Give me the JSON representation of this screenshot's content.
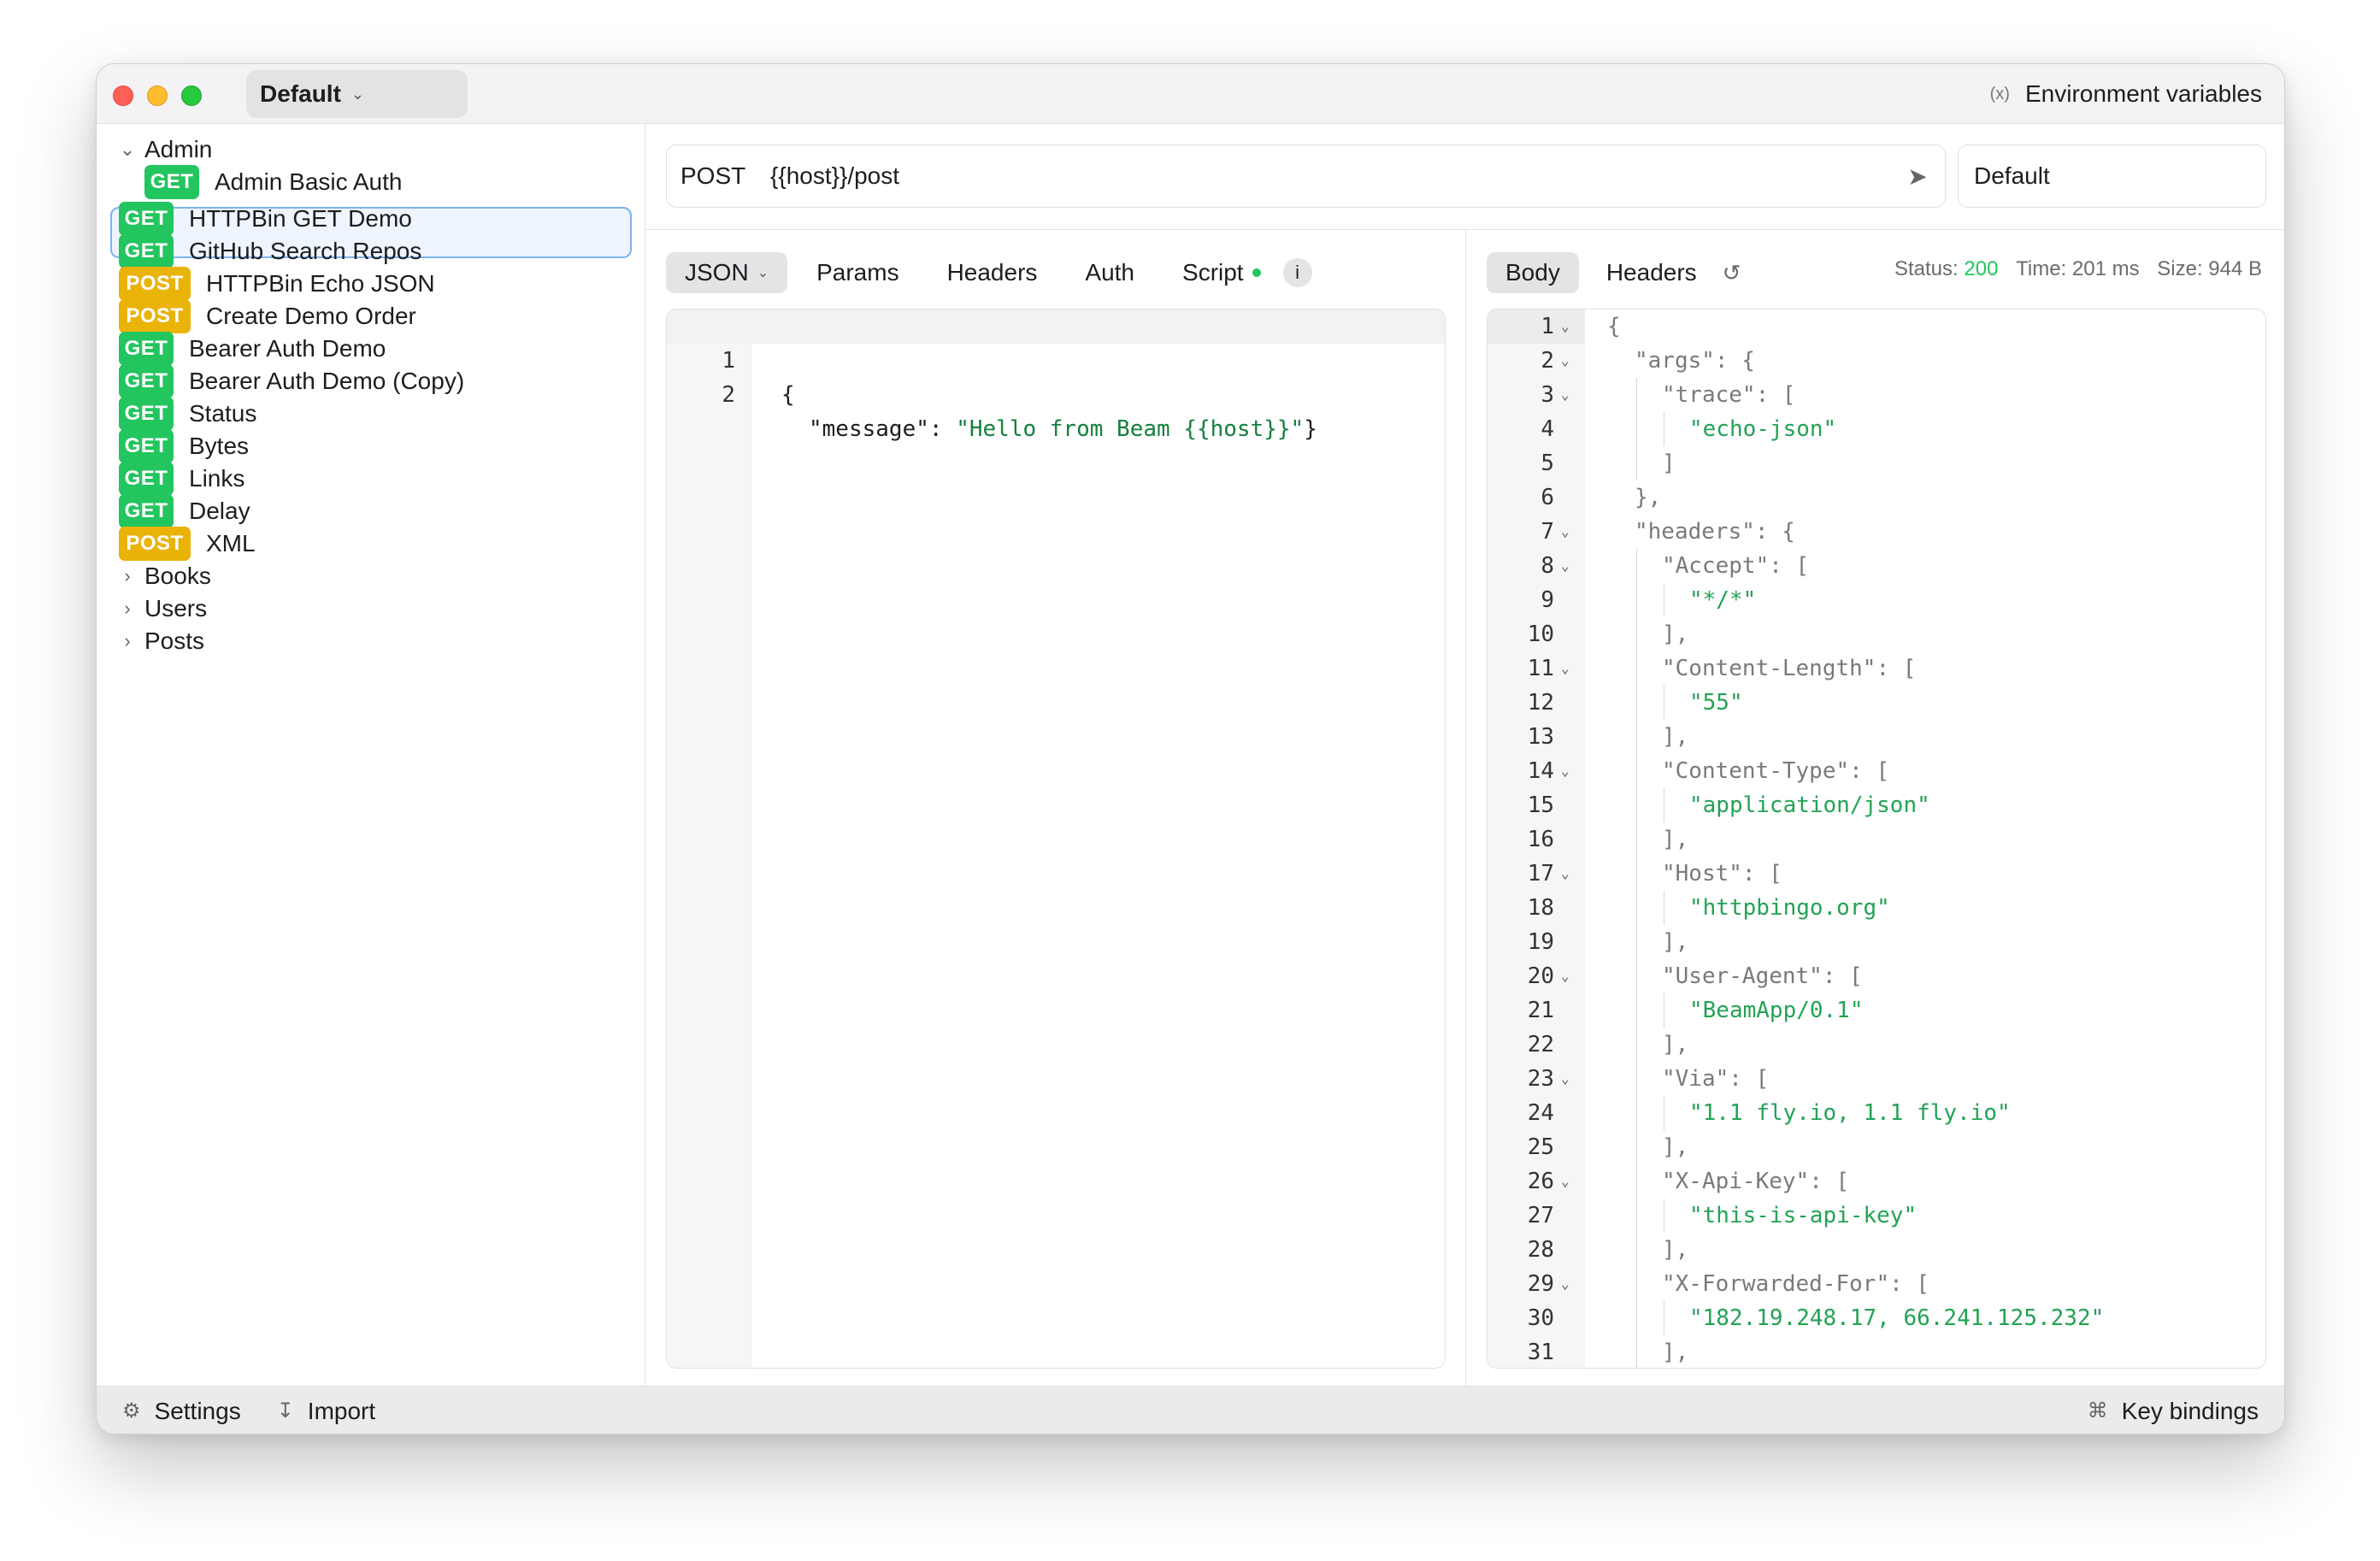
{
  "window": {
    "environment_selector": "Default",
    "env_variables_label": "Environment variables"
  },
  "sidebar": {
    "admin_folder": "Admin",
    "admin_items": [
      {
        "method": "GET",
        "label": "Admin Basic Auth"
      }
    ],
    "items": [
      {
        "method": "GET",
        "label": "HTTPBin GET Demo"
      },
      {
        "method": "GET",
        "label": "GitHub Search Repos"
      },
      {
        "method": "POST",
        "label": "HTTPBin Echo JSON",
        "selected": true
      },
      {
        "method": "POST",
        "label": "Create Demo Order"
      },
      {
        "method": "GET",
        "label": "Bearer Auth Demo"
      },
      {
        "method": "GET",
        "label": "Bearer Auth Demo (Copy)"
      },
      {
        "method": "GET",
        "label": "Status"
      },
      {
        "method": "GET",
        "label": "Bytes"
      },
      {
        "method": "GET",
        "label": "Links"
      },
      {
        "method": "GET",
        "label": "Delay"
      },
      {
        "method": "POST",
        "label": "XML"
      }
    ],
    "folders": [
      "Books",
      "Users",
      "Posts"
    ]
  },
  "request": {
    "method": "POST",
    "url": "{{host}}/post",
    "environment": "Default",
    "tabs": {
      "json": "JSON",
      "params": "Params",
      "headers": "Headers",
      "auth": "Auth",
      "script": "Script",
      "info": "i"
    },
    "body_lines": [
      {
        "n": "1",
        "text": "{"
      },
      {
        "n": "2",
        "text": "  \"message\": \"Hello from Beam {{host}}\"}"
      }
    ]
  },
  "response": {
    "tabs": {
      "body": "Body",
      "headers": "Headers"
    },
    "status_label": "Status:",
    "status_code": "200",
    "time_label": "Time: 201 ms",
    "size_label": "Size: 944 B",
    "lines": [
      {
        "n": "1",
        "fold": true,
        "indent": 0,
        "parts": [
          [
            "p",
            "{"
          ]
        ]
      },
      {
        "n": "2",
        "fold": true,
        "indent": 1,
        "parts": [
          [
            "k",
            "\"args\""
          ],
          [
            "p",
            ": {"
          ]
        ]
      },
      {
        "n": "3",
        "fold": true,
        "indent": 2,
        "parts": [
          [
            "k",
            "\"trace\""
          ],
          [
            "p",
            ": ["
          ]
        ]
      },
      {
        "n": "4",
        "fold": false,
        "indent": 3,
        "parts": [
          [
            "s",
            "\"echo-json\""
          ]
        ]
      },
      {
        "n": "5",
        "fold": false,
        "indent": 2,
        "parts": [
          [
            "p",
            "]"
          ]
        ]
      },
      {
        "n": "6",
        "fold": false,
        "indent": 1,
        "parts": [
          [
            "p",
            "},"
          ]
        ]
      },
      {
        "n": "7",
        "fold": true,
        "indent": 1,
        "parts": [
          [
            "k",
            "\"headers\""
          ],
          [
            "p",
            ": {"
          ]
        ]
      },
      {
        "n": "8",
        "fold": true,
        "indent": 2,
        "parts": [
          [
            "k",
            "\"Accept\""
          ],
          [
            "p",
            ": ["
          ]
        ]
      },
      {
        "n": "9",
        "fold": false,
        "indent": 3,
        "parts": [
          [
            "s",
            "\"*/*\""
          ]
        ]
      },
      {
        "n": "10",
        "fold": false,
        "indent": 2,
        "parts": [
          [
            "p",
            "],"
          ]
        ]
      },
      {
        "n": "11",
        "fold": true,
        "indent": 2,
        "parts": [
          [
            "k",
            "\"Content-Length\""
          ],
          [
            "p",
            ": ["
          ]
        ]
      },
      {
        "n": "12",
        "fold": false,
        "indent": 3,
        "parts": [
          [
            "s",
            "\"55\""
          ]
        ]
      },
      {
        "n": "13",
        "fold": false,
        "indent": 2,
        "parts": [
          [
            "p",
            "],"
          ]
        ]
      },
      {
        "n": "14",
        "fold": true,
        "indent": 2,
        "parts": [
          [
            "k",
            "\"Content-Type\""
          ],
          [
            "p",
            ": ["
          ]
        ]
      },
      {
        "n": "15",
        "fold": false,
        "indent": 3,
        "parts": [
          [
            "s",
            "\"application/json\""
          ]
        ]
      },
      {
        "n": "16",
        "fold": false,
        "indent": 2,
        "parts": [
          [
            "p",
            "],"
          ]
        ]
      },
      {
        "n": "17",
        "fold": true,
        "indent": 2,
        "parts": [
          [
            "k",
            "\"Host\""
          ],
          [
            "p",
            ": ["
          ]
        ]
      },
      {
        "n": "18",
        "fold": false,
        "indent": 3,
        "parts": [
          [
            "s",
            "\"httpbingo.org\""
          ]
        ]
      },
      {
        "n": "19",
        "fold": false,
        "indent": 2,
        "parts": [
          [
            "p",
            "],"
          ]
        ]
      },
      {
        "n": "20",
        "fold": true,
        "indent": 2,
        "parts": [
          [
            "k",
            "\"User-Agent\""
          ],
          [
            "p",
            ": ["
          ]
        ]
      },
      {
        "n": "21",
        "fold": false,
        "indent": 3,
        "parts": [
          [
            "s",
            "\"BeamApp/0.1\""
          ]
        ]
      },
      {
        "n": "22",
        "fold": false,
        "indent": 2,
        "parts": [
          [
            "p",
            "],"
          ]
        ]
      },
      {
        "n": "23",
        "fold": true,
        "indent": 2,
        "parts": [
          [
            "k",
            "\"Via\""
          ],
          [
            "p",
            ": ["
          ]
        ]
      },
      {
        "n": "24",
        "fold": false,
        "indent": 3,
        "parts": [
          [
            "s",
            "\"1.1 fly.io, 1.1 fly.io\""
          ]
        ]
      },
      {
        "n": "25",
        "fold": false,
        "indent": 2,
        "parts": [
          [
            "p",
            "],"
          ]
        ]
      },
      {
        "n": "26",
        "fold": true,
        "indent": 2,
        "parts": [
          [
            "k",
            "\"X-Api-Key\""
          ],
          [
            "p",
            ": ["
          ]
        ]
      },
      {
        "n": "27",
        "fold": false,
        "indent": 3,
        "parts": [
          [
            "s",
            "\"this-is-api-key\""
          ]
        ]
      },
      {
        "n": "28",
        "fold": false,
        "indent": 2,
        "parts": [
          [
            "p",
            "],"
          ]
        ]
      },
      {
        "n": "29",
        "fold": true,
        "indent": 2,
        "parts": [
          [
            "k",
            "\"X-Forwarded-For\""
          ],
          [
            "p",
            ": ["
          ]
        ]
      },
      {
        "n": "30",
        "fold": false,
        "indent": 3,
        "parts": [
          [
            "s",
            "\"182.19.248.17, 66.241.125.232\""
          ]
        ]
      },
      {
        "n": "31",
        "fold": false,
        "indent": 2,
        "parts": [
          [
            "p",
            "],"
          ]
        ]
      }
    ]
  },
  "footer": {
    "settings": "Settings",
    "import": "Import",
    "key_bindings": "Key bindings"
  },
  "icons": {
    "settings": "gear-icon",
    "import": "import-icon",
    "key_bindings": "command-icon",
    "send": "send-icon",
    "history": "history-icon",
    "env_vars": "variable-icon"
  },
  "colors": {
    "get_badge": "#22c55e",
    "post_badge": "#eab308",
    "status_ok": "#22c55e",
    "selection_border": "#7fb2ef"
  }
}
